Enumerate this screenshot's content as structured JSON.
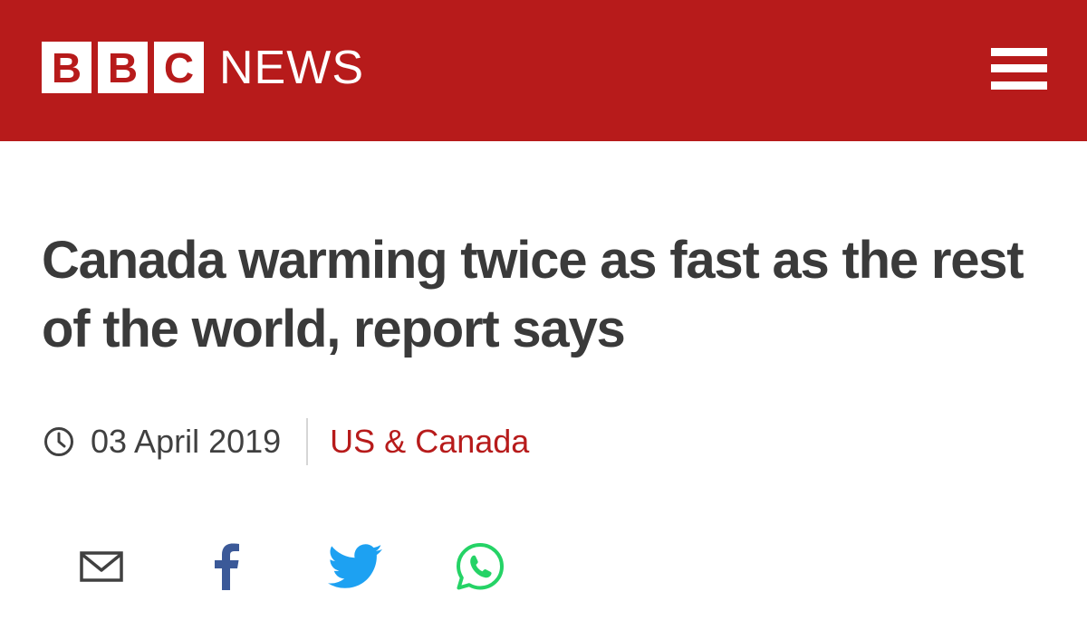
{
  "header": {
    "logo_letters": [
      "B",
      "B",
      "C"
    ],
    "logo_word": "NEWS",
    "menu_icon": "hamburger-menu-icon",
    "brand_color": "#b71b1b"
  },
  "article": {
    "headline": "Canada warming twice as fast as the rest of the world, report says",
    "date": "03 April 2019",
    "date_icon": "clock-icon",
    "section": "US & Canada",
    "headline_color": "#3a3a3a"
  },
  "share": [
    {
      "icon": "email-icon",
      "color": "#404040"
    },
    {
      "icon": "facebook-icon",
      "color": "#3b5998"
    },
    {
      "icon": "twitter-icon",
      "color": "#1da1f2"
    },
    {
      "icon": "whatsapp-icon",
      "color": "#25d366"
    }
  ]
}
